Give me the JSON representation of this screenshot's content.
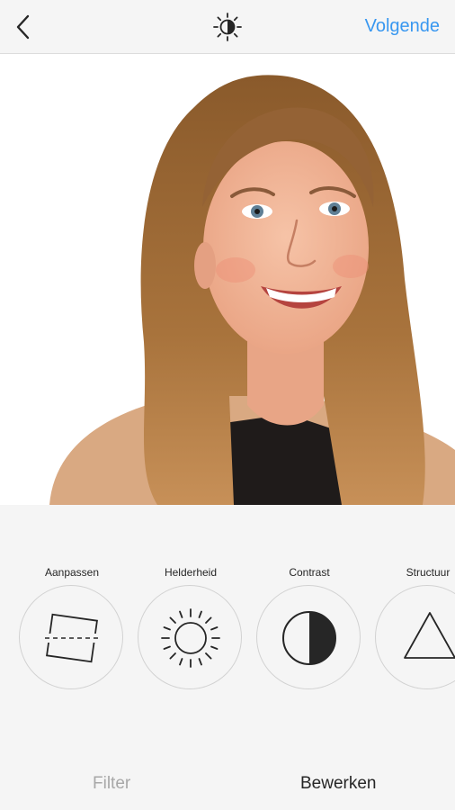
{
  "header": {
    "next_label": "Volgende"
  },
  "tools": [
    {
      "label": "Aanpassen",
      "icon": "adjust-icon"
    },
    {
      "label": "Helderheid",
      "icon": "brightness-icon"
    },
    {
      "label": "Contrast",
      "icon": "contrast-icon"
    },
    {
      "label": "Structuur",
      "icon": "structure-icon"
    }
  ],
  "tabs": {
    "filter": "Filter",
    "edit": "Bewerken"
  },
  "colors": {
    "accent": "#3897f0",
    "inactive_tab": "#a8a8a8",
    "active_tab": "#262626"
  }
}
